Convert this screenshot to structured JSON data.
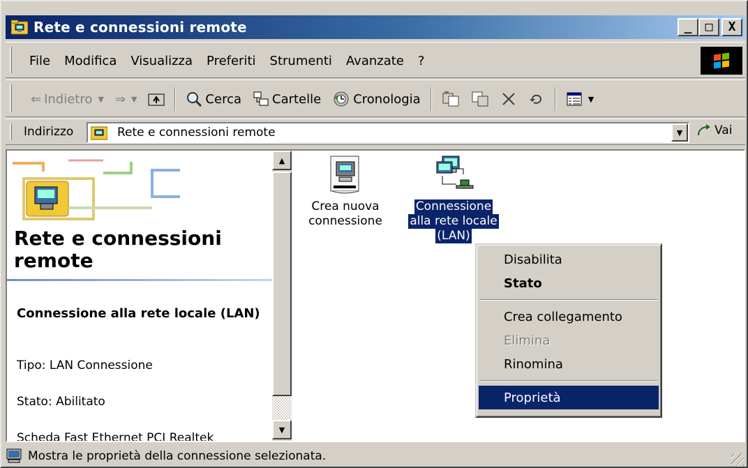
{
  "window": {
    "title": "Rete e connessioni remote",
    "buttons": {
      "minimize": "_",
      "maximize": "□",
      "close": "X"
    }
  },
  "menubar": {
    "items": [
      "File",
      "Modifica",
      "Visualizza",
      "Preferiti",
      "Strumenti",
      "Avanzate",
      "?"
    ]
  },
  "toolbar": {
    "back": "Indietro",
    "search": "Cerca",
    "folders": "Cartelle",
    "history": "Cronologia"
  },
  "addressbar": {
    "label": "Indirizzo",
    "value": "Rete e connessioni remote",
    "go": "Vai"
  },
  "leftpane": {
    "title": "Rete e connessioni remote",
    "selected_heading": "Connessione alla rete locale (LAN)",
    "type": "Tipo: LAN Connessione",
    "status": "Stato: Abilitato",
    "adapter": "Scheda Fast Ethernet PCI Realtek"
  },
  "icons": [
    {
      "label_line1": "Crea nuova",
      "label_line2": "connessione",
      "label_line3": "",
      "icon": "new-connection-icon",
      "selected": false
    },
    {
      "label_line1": "Connessione",
      "label_line2": "alla rete locale",
      "label_line3": "(LAN)",
      "icon": "lan-connection-icon",
      "selected": true
    }
  ],
  "context_menu": {
    "items": [
      {
        "label": "Disabilita",
        "state": "normal"
      },
      {
        "label": "Stato",
        "state": "default"
      },
      {
        "label": "Crea collegamento",
        "state": "normal"
      },
      {
        "label": "Elimina",
        "state": "disabled"
      },
      {
        "label": "Rinomina",
        "state": "normal"
      },
      {
        "label": "Proprietà",
        "state": "highlighted"
      }
    ]
  },
  "statusbar": {
    "text": "Mostra le proprietà della connessione selezionata."
  },
  "colors": {
    "titlebar_start": "#0a246a",
    "titlebar_end": "#a6caf0",
    "selection": "#0a246a",
    "face": "#d4d0c8"
  }
}
